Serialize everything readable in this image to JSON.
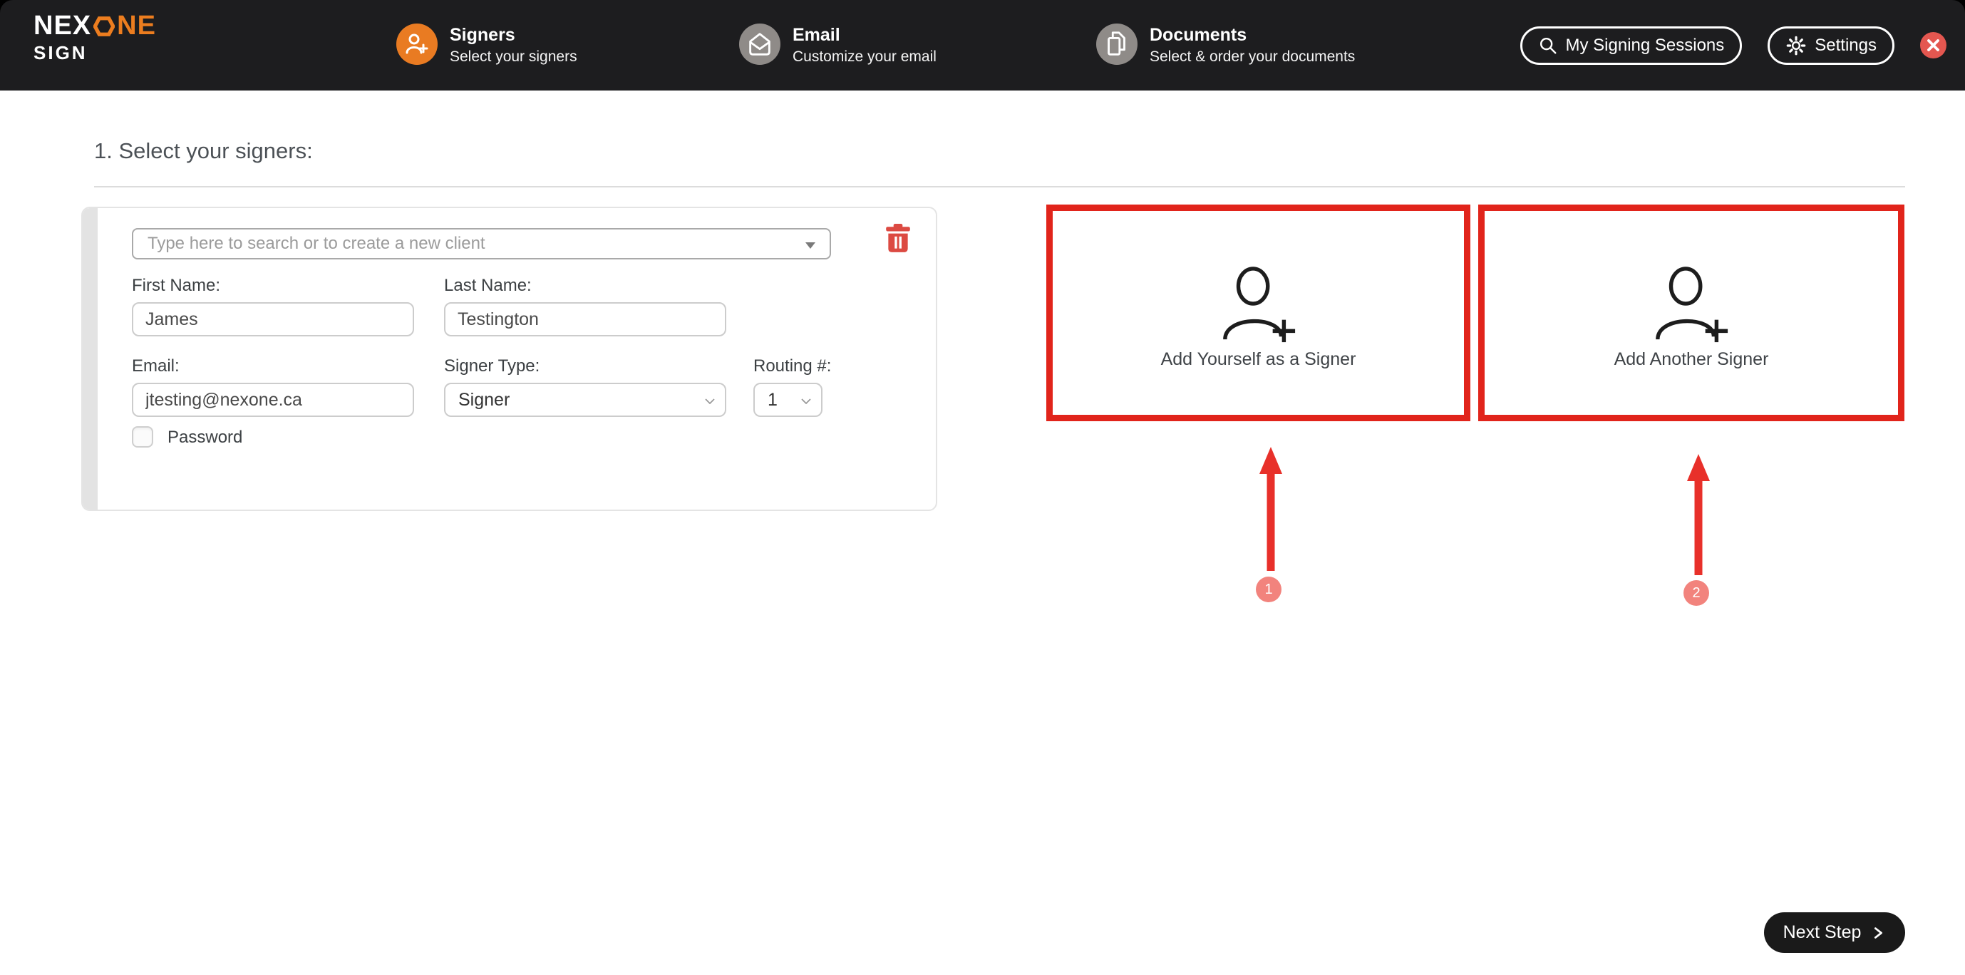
{
  "colors": {
    "navbar_bg": "#1d1d1f",
    "brand_orange": "#ec7d1f",
    "step_idle_gray": "#8f8b88",
    "close_red": "#e45750",
    "annotation_red": "#e1241b",
    "arrow_red": "#e8302a",
    "badge_pink": "#f2837d",
    "trash_red": "#dc4a42",
    "divider_gray": "#dcdcdc",
    "card_strip_gray": "#e3e3e3",
    "next_btn_black": "#1a1a1a"
  },
  "icons": {
    "logo_o": "hexagon",
    "signers_step": "person-plus",
    "email_step": "open-envelope",
    "documents_step": "stacked-documents",
    "sessions": "magnifier",
    "settings": "gear",
    "close": "x",
    "search_caret": "triangle-down",
    "select_chevron": "chevron-down",
    "delete": "trash",
    "add_signer": "person-plus-outline",
    "next": "chevron-right"
  },
  "navbar": {
    "logo": {
      "prefix": "NEX",
      "suffix": "NE",
      "subtitle": "SIGN"
    },
    "steps": [
      {
        "title": "Signers",
        "subtitle": "Select your signers"
      },
      {
        "title": "Email",
        "subtitle": "Customize your email"
      },
      {
        "title": "Documents",
        "subtitle": "Select & order your documents"
      }
    ],
    "actions": {
      "sessions_label": "My Signing Sessions",
      "settings_label": "Settings"
    }
  },
  "main": {
    "heading": "1. Select your signers:",
    "signer_card": {
      "search_placeholder": "Type here to search or to create a new client",
      "first_name_label": "First Name:",
      "first_name_value": "James",
      "last_name_label": "Last Name:",
      "last_name_value": "Testington",
      "email_label": "Email:",
      "email_value": "jtesting@nexone.ca",
      "signer_type_label": "Signer Type:",
      "signer_type_value": "Signer",
      "routing_label": "Routing #:",
      "routing_value": "1",
      "password_label": "Password",
      "password_checked": false
    },
    "add_yourself_label": "Add Yourself as a Signer",
    "add_another_label": "Add Another Signer",
    "annotations": [
      {
        "number": "1"
      },
      {
        "number": "2"
      }
    ]
  },
  "footer": {
    "next_label": "Next Step"
  }
}
